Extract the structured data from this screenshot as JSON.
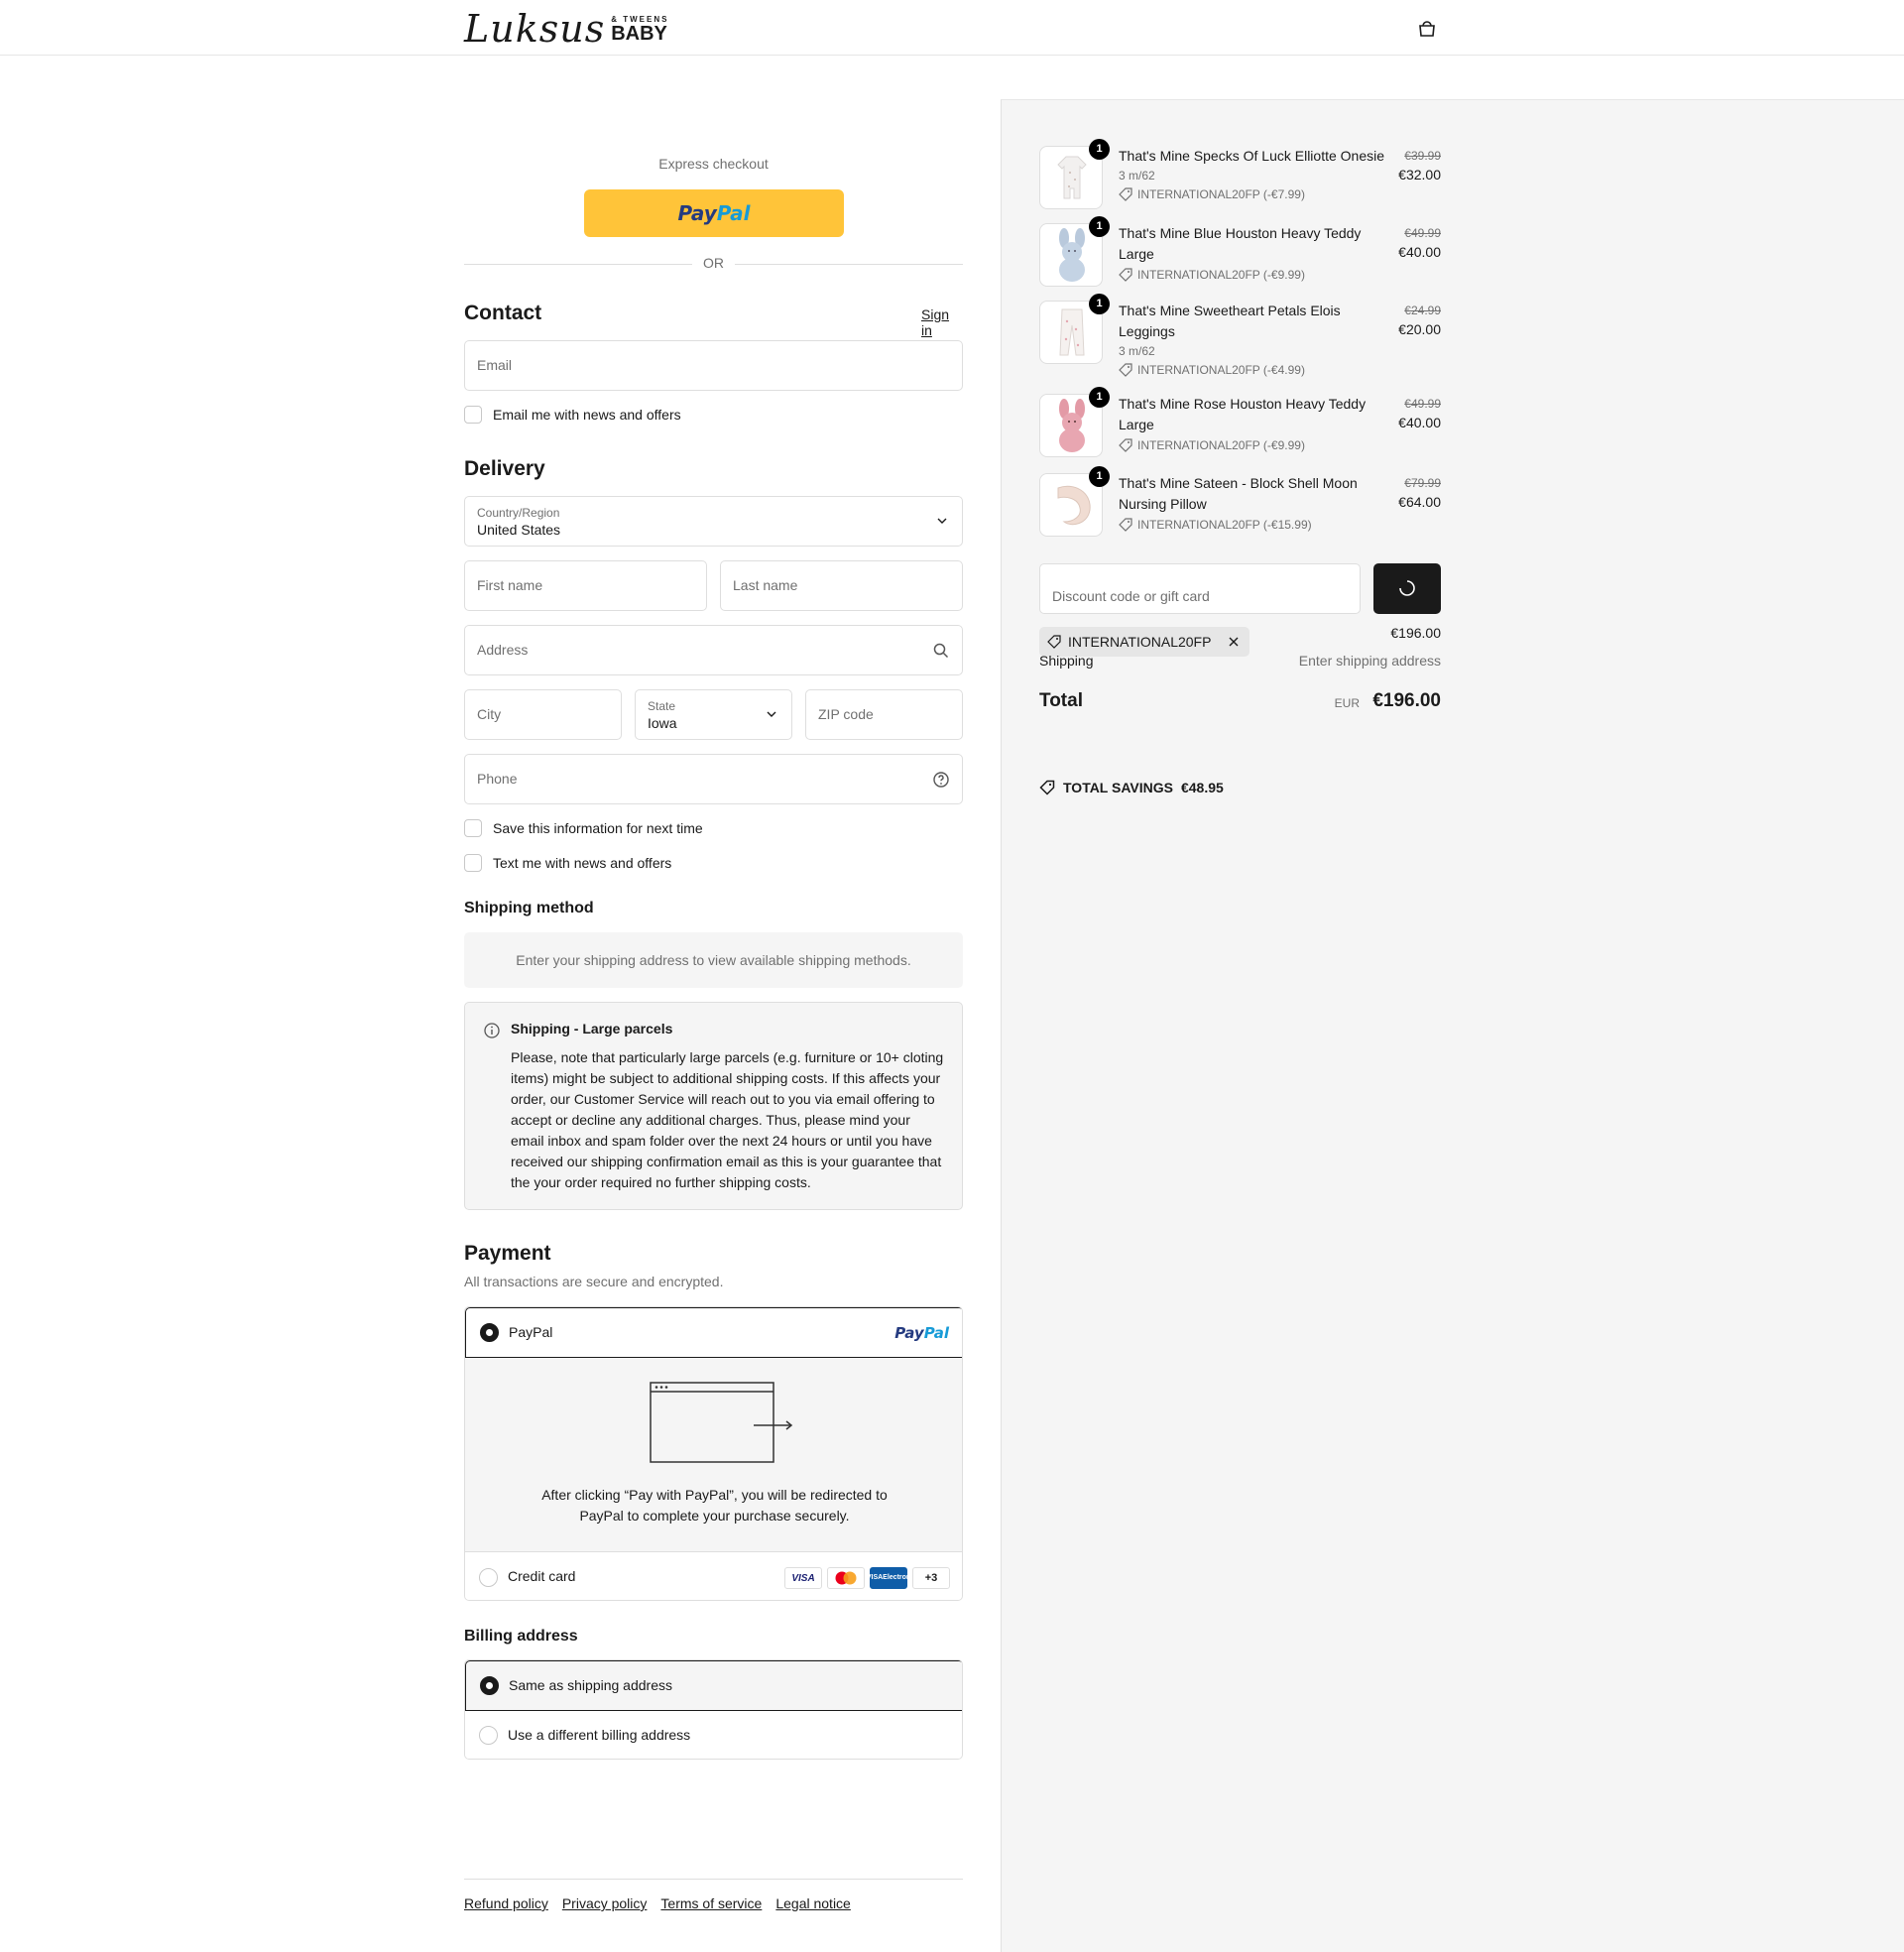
{
  "brand": {
    "logo_script": "Luksus",
    "logo_sub": "& TWEENS",
    "logo_main": "BABY"
  },
  "express": {
    "label": "Express checkout",
    "paypal_part1": "Pay",
    "paypal_part2": "Pal",
    "or": "OR"
  },
  "contact": {
    "title": "Contact",
    "signin": "Sign in",
    "email_placeholder": "Email",
    "news_label": "Email me with news and offers"
  },
  "delivery": {
    "title": "Delivery",
    "country_label": "Country/Region",
    "country_value": "United States",
    "first_name_placeholder": "First name",
    "last_name_placeholder": "Last name",
    "address_placeholder": "Address",
    "city_placeholder": "City",
    "state_label": "State",
    "state_value": "Iowa",
    "zip_placeholder": "ZIP code",
    "phone_placeholder": "Phone",
    "save_label": "Save this information for next time",
    "text_label": "Text me with news and offers"
  },
  "shipping_method": {
    "title": "Shipping method",
    "empty_text": "Enter your shipping address to view available shipping methods.",
    "notice_title": "Shipping - Large parcels",
    "notice_body": "Please, note that particularly large parcels (e.g. furniture or 10+ cloting items) might be subject to additional shipping costs. If this affects your order, our Customer Service will reach out to you via email offering to accept or decline any additional charges. Thus, please mind your email inbox and spam folder over the next 24 hours or until you have received our shipping confirmation email as this is your guarantee that the your order required no further shipping costs."
  },
  "payment": {
    "title": "Payment",
    "subtitle": "All transactions are secure and encrypted.",
    "paypal_label": "PayPal",
    "paypal_logo_part1": "Pay",
    "paypal_logo_part2": "Pal",
    "redirect_text": "After clicking “Pay with PayPal”, you will be redirected to PayPal to complete your purchase securely.",
    "cc_label": "Credit card",
    "card_visa": "VISA",
    "card_amex_line1": "VISA",
    "card_amex_line2": "Electron",
    "card_more": "+3"
  },
  "billing": {
    "title": "Billing address",
    "same_label": "Same as shipping address",
    "different_label": "Use a different billing address"
  },
  "footer": {
    "links": [
      "Refund policy",
      "Privacy policy",
      "Terms of service",
      "Legal notice"
    ]
  },
  "cart": {
    "items": [
      {
        "qty": "1",
        "name": "That's Mine Specks Of Luck Elliotte Onesie",
        "variant": "3 m/62",
        "discount": "INTERNATIONAL20FP (-€7.99)",
        "original": "€39.99",
        "price": "€32.00"
      },
      {
        "qty": "1",
        "name": "That's Mine Blue Houston Heavy Teddy Large",
        "variant": "",
        "discount": "INTERNATIONAL20FP (-€9.99)",
        "original": "€49.99",
        "price": "€40.00"
      },
      {
        "qty": "1",
        "name": "That's Mine Sweetheart Petals Elois Leggings",
        "variant": "3 m/62",
        "discount": "INTERNATIONAL20FP (-€4.99)",
        "original": "€24.99",
        "price": "€20.00"
      },
      {
        "qty": "1",
        "name": "That's Mine Rose Houston Heavy Teddy Large",
        "variant": "",
        "discount": "INTERNATIONAL20FP (-€9.99)",
        "original": "€49.99",
        "price": "€40.00"
      },
      {
        "qty": "1",
        "name": "That's Mine Sateen - Block Shell Moon Nursing Pillow",
        "variant": "",
        "discount": "INTERNATIONAL20FP (-€15.99)",
        "original": "€79.99",
        "price": "€64.00"
      }
    ],
    "discount_placeholder": "Discount code or gift card",
    "applied_code": "INTERNATIONAL20FP",
    "subtotal_value": "€196.00",
    "shipping_label": "Shipping",
    "shipping_value": "Enter shipping address",
    "total_label": "Total",
    "total_currency": "EUR",
    "total_value": "€196.00",
    "savings_label": "TOTAL SAVINGS",
    "savings_value": "€48.95"
  },
  "colors": {
    "paypal_yellow": "#ffc439",
    "paypal_dark": "#253b80",
    "paypal_light": "#179bd7",
    "summary_bg": "#f5f5f5",
    "accent_dark": "#1a1a1a"
  }
}
